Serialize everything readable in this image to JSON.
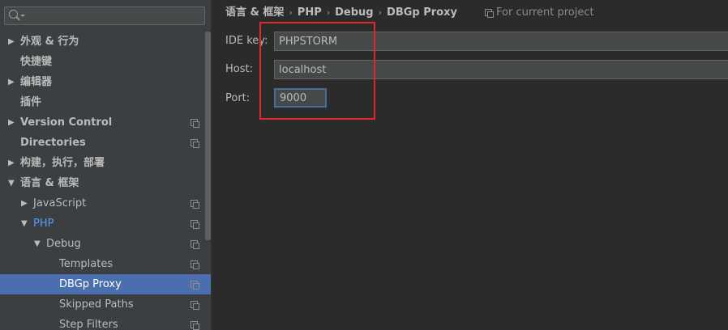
{
  "search": {
    "value": "",
    "placeholder": ""
  },
  "sidebar": {
    "items": [
      {
        "label": "外观 & 行为",
        "arrow": "▶",
        "project": false
      },
      {
        "label": "快捷键",
        "arrow": "",
        "project": false
      },
      {
        "label": "编辑器",
        "arrow": "▶",
        "project": false
      },
      {
        "label": "插件",
        "arrow": "",
        "project": false
      },
      {
        "label": "Version Control",
        "arrow": "▶",
        "project": true
      },
      {
        "label": "Directories",
        "arrow": "",
        "project": true
      },
      {
        "label": "构建，执行，部署",
        "arrow": "▶",
        "project": false
      },
      {
        "label": "语言 & 框架",
        "arrow": "▼",
        "project": false
      },
      {
        "label": "JavaScript",
        "arrow": "▶",
        "project": true
      },
      {
        "label": "PHP",
        "arrow": "▼",
        "project": true
      },
      {
        "label": "Debug",
        "arrow": "▼",
        "project": true
      },
      {
        "label": "Templates",
        "arrow": "",
        "project": true
      },
      {
        "label": "DBGp Proxy",
        "arrow": "",
        "project": true
      },
      {
        "label": "Skipped Paths",
        "arrow": "",
        "project": true
      },
      {
        "label": "Step Filters",
        "arrow": "",
        "project": true
      }
    ]
  },
  "breadcrumb": {
    "items": [
      "语言 & 框架",
      "PHP",
      "Debug",
      "DBGp Proxy"
    ],
    "separator": "›"
  },
  "scope": {
    "label": "For current project"
  },
  "form": {
    "ide_key": {
      "label": "IDE key:",
      "value": "PHPSTORM"
    },
    "host": {
      "label": "Host:",
      "value": "localhost"
    },
    "port": {
      "label": "Port:",
      "value": "9000"
    }
  },
  "colors": {
    "background": "#2b2b2b",
    "sidebar": "#3c3f41",
    "selection": "#4b6eaf",
    "php_link": "#589df6",
    "highlight_box": "#e0282a"
  }
}
